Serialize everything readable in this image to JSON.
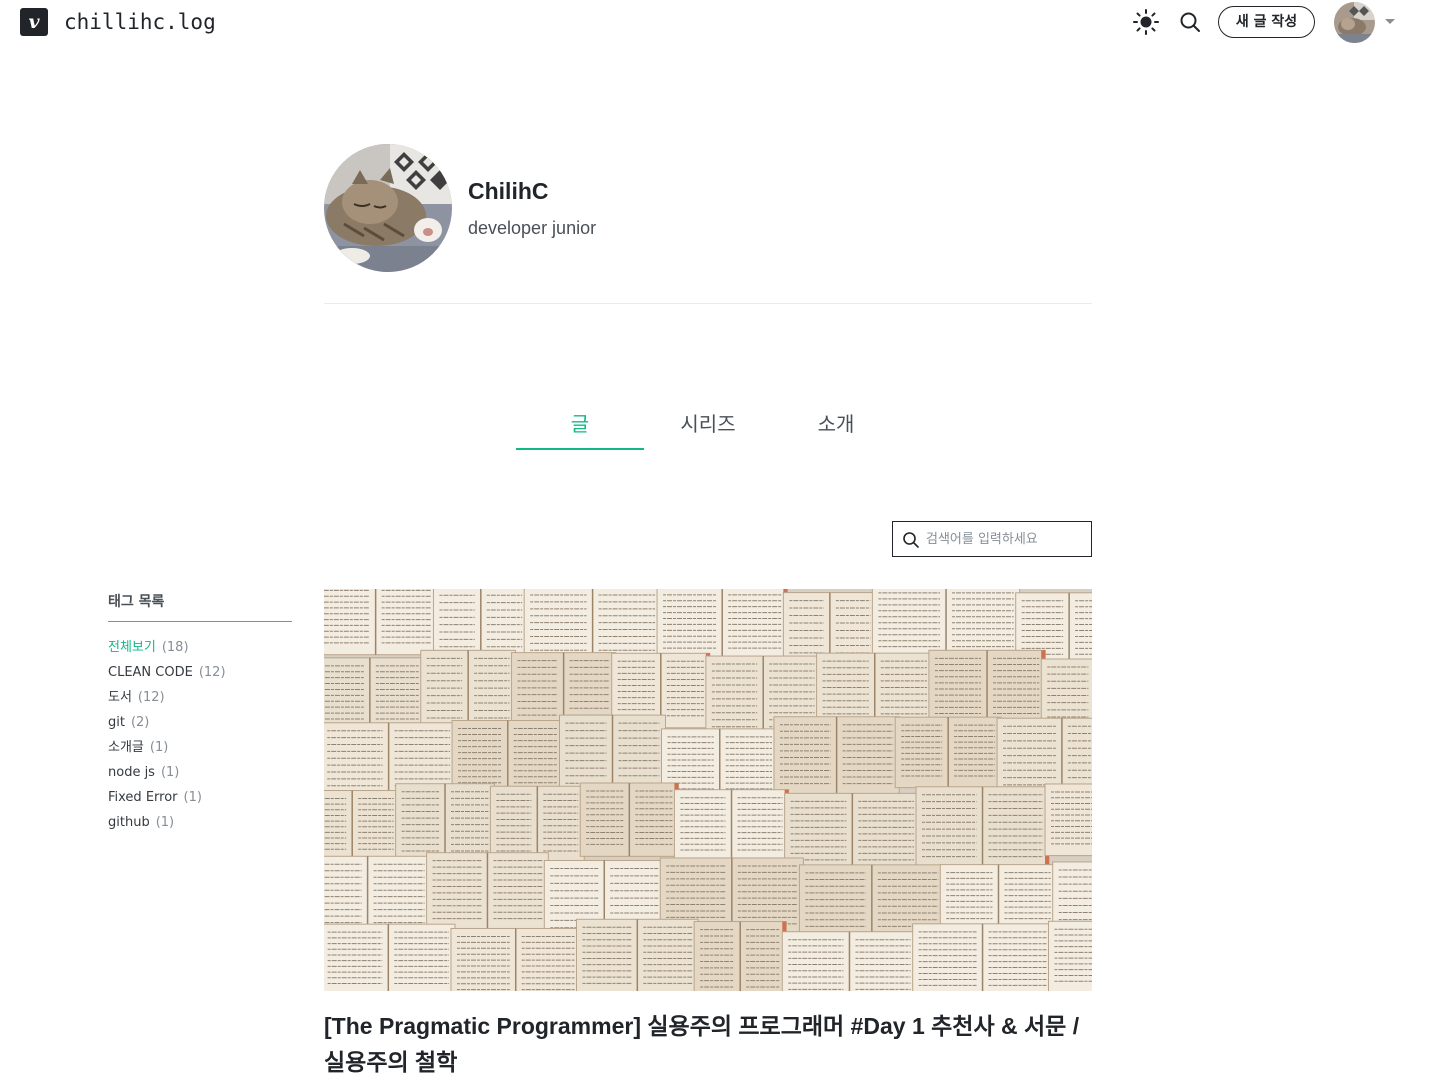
{
  "header": {
    "logo_letter": "v",
    "blog_name": "chillihc.log",
    "write_button": "새 글 작성"
  },
  "profile": {
    "name": "ChilihC",
    "description": "developer junior"
  },
  "tabs": [
    {
      "label": "글",
      "active": true
    },
    {
      "label": "시리즈",
      "active": false
    },
    {
      "label": "소개",
      "active": false
    }
  ],
  "search": {
    "placeholder": "검색어를 입력하세요",
    "value": ""
  },
  "tags": {
    "title": "태그 목록",
    "items": [
      {
        "name": "전체보기",
        "count": "(18)",
        "active": true
      },
      {
        "name": "CLEAN CODE",
        "count": "(12)",
        "active": false
      },
      {
        "name": "도서",
        "count": "(12)",
        "active": false
      },
      {
        "name": "git",
        "count": "(2)",
        "active": false
      },
      {
        "name": "소개글",
        "count": "(1)",
        "active": false
      },
      {
        "name": "node js",
        "count": "(1)",
        "active": false
      },
      {
        "name": "Fixed Error",
        "count": "(1)",
        "active": false
      },
      {
        "name": "github",
        "count": "(1)",
        "active": false
      }
    ]
  },
  "post": {
    "title": "[The Pragmatic Programmer] 실용주의 프로그래머 #Day 1 추천사 & 서문 / 실용주의 철학"
  },
  "colors": {
    "accent": "#12b886",
    "text": "#212529",
    "muted": "#868e96"
  }
}
